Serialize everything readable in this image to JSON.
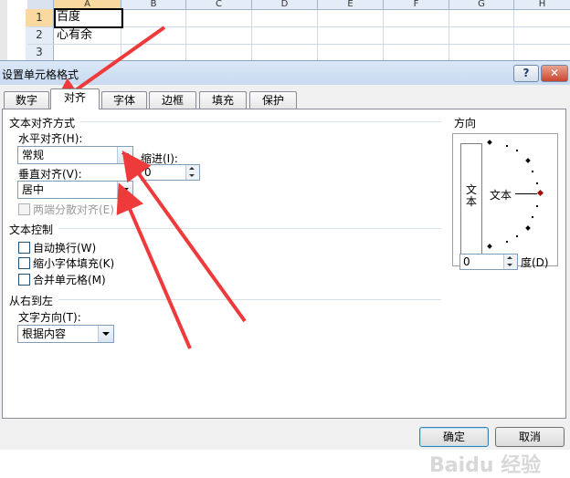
{
  "sheet": {
    "columns": [
      "A",
      "B",
      "C",
      "D",
      "E",
      "F",
      "G",
      "H"
    ],
    "rows": [
      "1",
      "2",
      "3"
    ],
    "cells": [
      "百度",
      "心有余"
    ]
  },
  "dialog": {
    "title": "设置单元格格式",
    "help_label": "?",
    "close_label": "✕",
    "tabs": [
      "数字",
      "对齐",
      "字体",
      "边框",
      "填充",
      "保护"
    ],
    "active_tab": "对齐",
    "text_alignment": {
      "group_label": "文本对齐方式",
      "horizontal_label": "水平对齐(H):",
      "horizontal_value": "常规",
      "indent_label": "缩进(I):",
      "indent_value": "0",
      "vertical_label": "垂直对齐(V):",
      "vertical_value": "居中",
      "distributed_label": "两端分散对齐(E)"
    },
    "text_control": {
      "group_label": "文本控制",
      "wrap_label": "自动换行(W)",
      "shrink_label": "缩小字体填充(K)",
      "merge_label": "合并单元格(M)"
    },
    "rtl": {
      "group_label": "从右到左",
      "direction_label": "文字方向(T):",
      "direction_value": "根据内容"
    },
    "orientation": {
      "group_label": "方向",
      "vertical_text": "文本",
      "horizontal_text": "文本",
      "degrees_value": "0",
      "degrees_label": "度(D)"
    },
    "ok_label": "确定",
    "cancel_label": "取消"
  },
  "colors": {
    "annotation_arrow": "#ee3a3a",
    "selected_header": "#f9d99f"
  },
  "watermark": "Baidu 经验"
}
